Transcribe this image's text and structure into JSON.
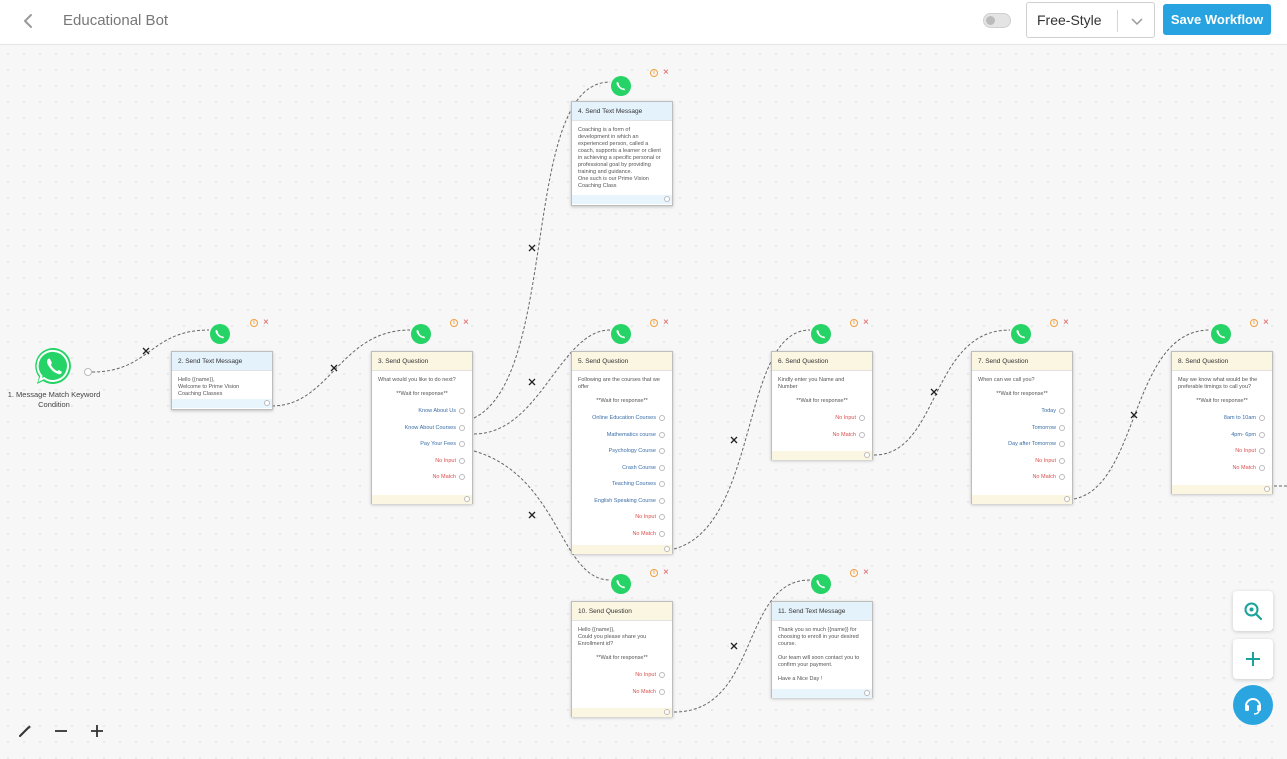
{
  "header": {
    "title": "Educational Bot",
    "mode": "Free-Style",
    "save_label": "Save Workflow"
  },
  "colors": {
    "accent": "#26a3e0",
    "whatsapp": "#25d366",
    "no_match": "#d9534f",
    "option": "#3a6ea8"
  },
  "start": {
    "label": "1. Message Match Keyword Condition",
    "icon": "whatsapp-icon"
  },
  "nodes": {
    "n2": {
      "title": "2. Send Text Message",
      "text": "Hello {{name}},\nWelcome to Prime Vision\nCoaching Classes"
    },
    "n3": {
      "title": "3. Send Question",
      "text": "What would you like to do next?",
      "wait": "**Wait for response**",
      "options": [
        "Know About Us",
        "Know About Courses",
        "Pay Your Fees",
        "No Input",
        "No Match"
      ]
    },
    "n4": {
      "title": "4. Send Text Message",
      "text": "Coaching is a form of\ndevelopment in which an\nexperienced person, called a\ncoach, supports a learner or client\nin achieving a specific personal or\nprofessional goal by providing\ntraining and guidance.\nOne such is our Prime Vision\nCoaching Class"
    },
    "n5": {
      "title": "5. Send Question",
      "text": "Following are the courses that we offer",
      "wait": "**Wait for response**",
      "options": [
        "Online Education Courses",
        "Mathematics course",
        "Psychology Course",
        "Crash Course",
        "Teaching Courses",
        "English Speaking Course",
        "No Input",
        "No Match"
      ]
    },
    "n6": {
      "title": "6. Send Question",
      "text": "Kindly enter you Name and\nNumber",
      "wait": "**Wait for response**",
      "options": [
        "No Input",
        "No Match"
      ]
    },
    "n7": {
      "title": "7. Send Question",
      "text": "When can we call you?",
      "wait": "**Wait for response**",
      "options": [
        "Today",
        "Tomorrow",
        "Day after Tomorrow",
        "No Input",
        "No Match"
      ]
    },
    "n8": {
      "title": "8. Send Question",
      "text": "May we know what would be the\npreferable timings to call you?",
      "wait": "**Wait for response**",
      "options": [
        "8am to 10am",
        "4pm- 6pm",
        "No Input",
        "No Match"
      ]
    },
    "n10": {
      "title": "10. Send Question",
      "text": "Hello {{name}},\nCould you please share you\nEnrollment id?",
      "wait": "**Wait for response**",
      "options": [
        "No Input",
        "No Match"
      ]
    },
    "n11": {
      "title": "11. Send Text Message",
      "text": "Thank you so much {{name}} for\nchoosing to enroll in your desired\ncourse.\n\nOur team will soon contact you to\nconfirm your payment.\n\nHave a Nice Day !"
    }
  },
  "controls": {
    "left": [
      "magic-wand-icon",
      "zoom-out-icon",
      "zoom-in-icon"
    ],
    "right": [
      "zoom-search-icon",
      "add-icon",
      "headset-icon"
    ]
  }
}
